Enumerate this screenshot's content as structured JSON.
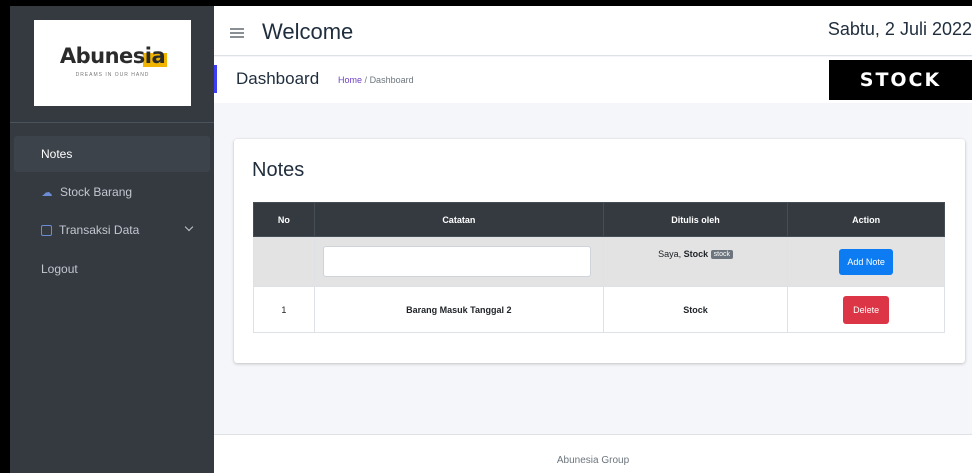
{
  "brand": {
    "name_main": "Abunes",
    "name_accent": "ia",
    "tagline": "DREAMS IN OUR HAND"
  },
  "sidebar": {
    "items": [
      {
        "label": "Notes",
        "icon": "none",
        "active": true
      },
      {
        "label": "Stock Barang",
        "icon": "cloud-icon",
        "active": false
      },
      {
        "label": "Transaksi Data",
        "icon": "table-icon",
        "active": false,
        "has_submenu": true
      },
      {
        "label": "Logout",
        "icon": "none",
        "active": false
      }
    ]
  },
  "header": {
    "title": "Welcome",
    "date": "Sabtu, 2 Juli 2022"
  },
  "subheader": {
    "page_title": "Dashboard",
    "breadcrumb_home": "Home",
    "breadcrumb_sep": "/",
    "breadcrumb_current": "Dashboard",
    "logo_text": "STOCK"
  },
  "notes_card": {
    "title": "Notes",
    "columns": [
      "No",
      "Catatan",
      "Ditulis oleh",
      "Action"
    ],
    "input_row": {
      "input_value": "",
      "author_prefix": "Saya, ",
      "author_name": "Stock",
      "author_badge": "stock",
      "button_label": "Add Note"
    },
    "rows": [
      {
        "no": "1",
        "catatan": "Barang Masuk Tanggal 2",
        "author": "Stock",
        "button_label": "Delete"
      }
    ]
  },
  "footer": {
    "text": "Abunesia Group"
  },
  "colors": {
    "sidebar": "#343a40",
    "primary": "#0d7cf2",
    "danger": "#dc3545",
    "accent": "#f0b400"
  }
}
